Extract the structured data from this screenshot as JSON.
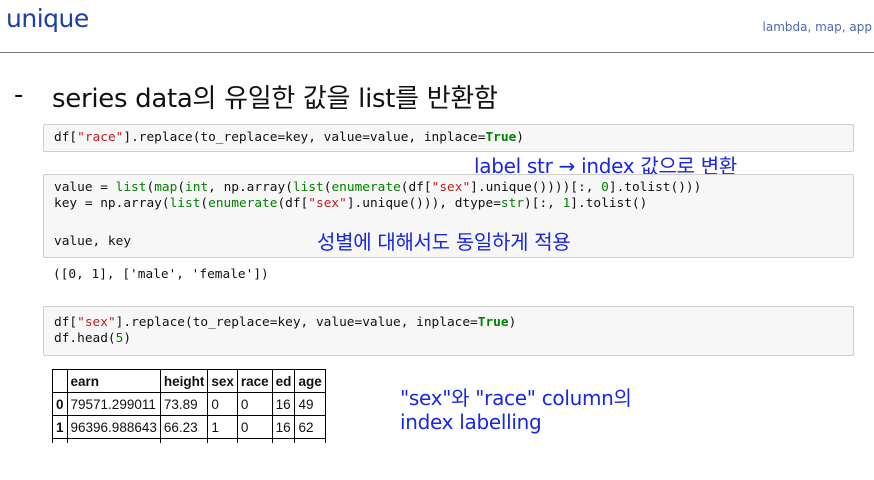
{
  "slide": {
    "title": "unique",
    "breadcrumb": "lambda, map, app",
    "bullet": "-",
    "heading": "series data의 유일한 값을 list를 반환함"
  },
  "cells": {
    "cell1": {
      "line1": {
        "p1": "df[",
        "s1": "\"race\"",
        "p2": "].replace(to_replace=key, value=value, inplace=",
        "k1": "True",
        "p3": ")"
      }
    },
    "cell2": {
      "line1": {
        "p1": "value = ",
        "b1": "list",
        "p2": "(",
        "b2": "map",
        "p3": "(",
        "b3": "int",
        "p4": ", np.array(",
        "b4": "list",
        "p5": "(",
        "b5": "enumerate",
        "p6": "(df[",
        "s1": "\"sex\"",
        "p7": "].unique())))[:, ",
        "n1": "0",
        "p8": "].tolist()))"
      },
      "line2": {
        "p1": "key = np.array(",
        "b1": "list",
        "p2": "(",
        "b2": "enumerate",
        "p3": "(df[",
        "s1": "\"sex\"",
        "p4": "].unique())), dtype=",
        "b3": "str",
        "p5": ")[:, ",
        "n1": "1",
        "p6": "].tolist()"
      },
      "line3": "value, key",
      "output": "([0, 1], ['male', 'female'])"
    },
    "cell3": {
      "line1": {
        "p1": "df[",
        "s1": "\"sex\"",
        "p2": "].replace(to_replace=key, value=value, inplace=",
        "k1": "True",
        "p3": ")"
      },
      "line2": {
        "p1": "df.head(",
        "n1": "5",
        "p2": ")"
      }
    }
  },
  "annotations": {
    "label_to_index": "label str → index 값으로 변환",
    "same_for_sex": "성별에 대해서도 동일하게 적용",
    "column_note_line1": "\"sex\"와 \"race\" column의",
    "column_note_line2": "index labelling"
  },
  "dataframe": {
    "columns": [
      "",
      "earn",
      "height",
      "sex",
      "race",
      "ed",
      "age"
    ],
    "rows": [
      [
        "0",
        "79571.299011",
        "73.89",
        "0",
        "0",
        "16",
        "49"
      ],
      [
        "1",
        "96396.988643",
        "66.23",
        "1",
        "0",
        "16",
        "62"
      ]
    ]
  },
  "colors": {
    "title": "#1f3fa6",
    "annotation": "#1826e6",
    "code_string": "#ba2121",
    "code_keyword": "#008000"
  }
}
